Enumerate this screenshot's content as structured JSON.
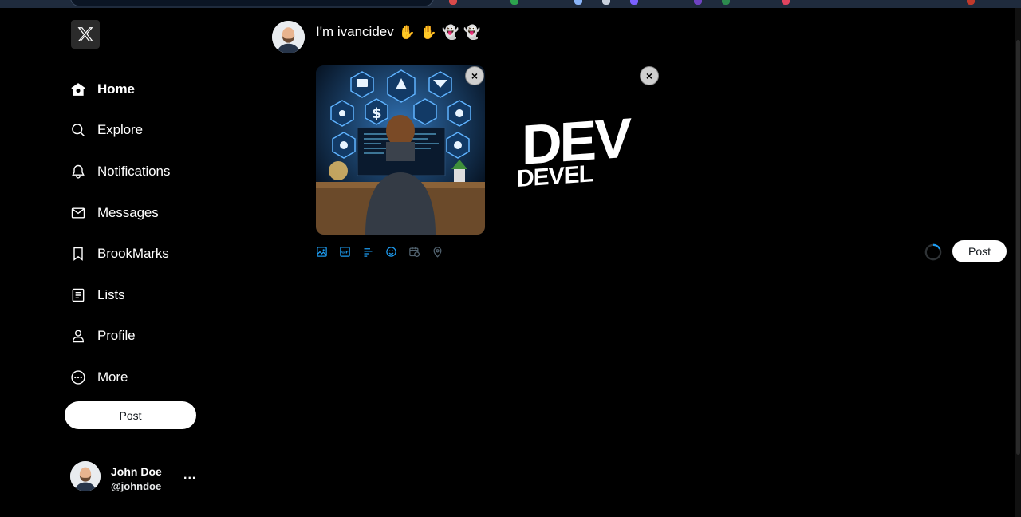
{
  "sidebar": {
    "logo_icon": "x-logo-icon",
    "items": [
      {
        "label": "Home",
        "icon": "home-icon",
        "active": true
      },
      {
        "label": "Explore",
        "icon": "search-icon"
      },
      {
        "label": "Notifications",
        "icon": "bell-icon"
      },
      {
        "label": "Messages",
        "icon": "mail-icon"
      },
      {
        "label": "BrookMarks",
        "icon": "bookmark-icon"
      },
      {
        "label": "Lists",
        "icon": "list-icon"
      },
      {
        "label": "Profile",
        "icon": "person-icon"
      },
      {
        "label": "More",
        "icon": "more-circle-icon"
      }
    ],
    "post_label": "Post"
  },
  "user": {
    "name": "John Doe",
    "handle": "@johndoe",
    "more": "..."
  },
  "composer": {
    "text": "I'm ivancidev",
    "emojis": [
      "✋",
      "✋",
      "👻",
      "👻"
    ],
    "media": [
      {
        "name": "developer-illustration-image",
        "remove_label": "×"
      },
      {
        "name": "dev-logo-image",
        "remove_label": "×"
      }
    ],
    "media_logo_text": "DEV",
    "media_logo_subtext": "DEVEL",
    "tools": [
      "image-icon",
      "gif-icon",
      "poll-icon",
      "emoji-icon",
      "schedule-icon",
      "location-icon"
    ],
    "post_label": "Post"
  },
  "colors": {
    "accent": "#1d9bf0",
    "background": "#000000",
    "button": "#ffffff"
  }
}
